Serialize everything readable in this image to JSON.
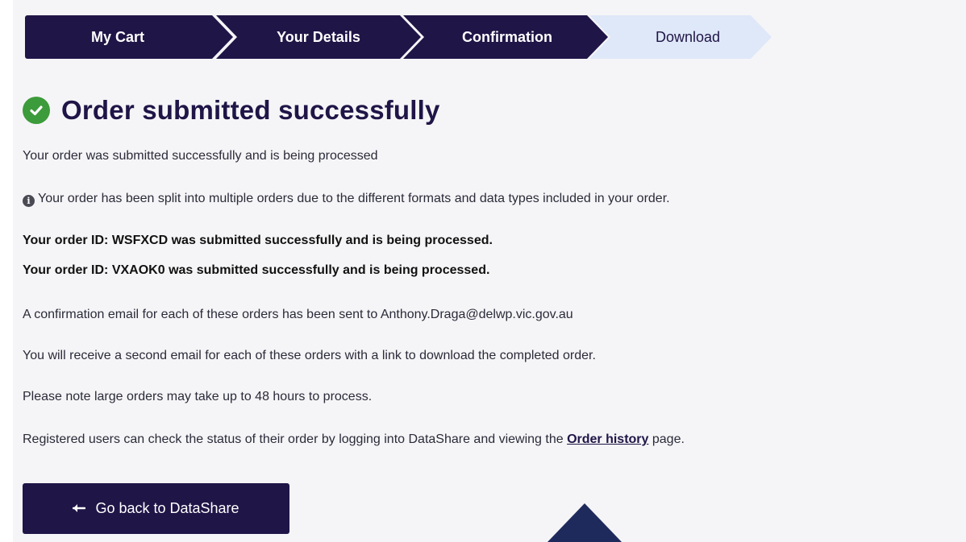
{
  "stepper": {
    "steps": [
      {
        "label": "My Cart",
        "state": "done"
      },
      {
        "label": "Your Details",
        "state": "done"
      },
      {
        "label": "Confirmation",
        "state": "done"
      },
      {
        "label": "Download",
        "state": "current"
      }
    ]
  },
  "heading": {
    "title": "Order submitted successfully",
    "icon": "check-circle-icon"
  },
  "messages": {
    "processing": "Your order was submitted successfully and is being processed",
    "split_notice": "Your order has been split into multiple orders due to the different formats and data types included in your order.",
    "order_1": "Your order ID: WSFXCD was submitted successfully and is being processed.",
    "order_2": "Your order ID: VXAOK0 was submitted successfully and is being processed.",
    "email_sent": "A confirmation email for each of these orders has been sent to Anthony.Draga@delwp.vic.gov.au",
    "second_email": "You will receive a second email for each of these orders with a link to download the completed order.",
    "note": "Please note large orders may take up to 48 hours to process.",
    "registered_prefix": "Registered users can check the status of their order by logging into DataShare and viewing the ",
    "registered_link": "Order history",
    "registered_suffix": " page."
  },
  "actions": {
    "back_label": "Go back to DataShare",
    "back_icon": "arrow-left-icon",
    "scroll_icon": "chevron-up-icon"
  },
  "colors": {
    "primary": "#201547",
    "current_step": "#dfe8f8",
    "success": "#3c9b3a"
  }
}
